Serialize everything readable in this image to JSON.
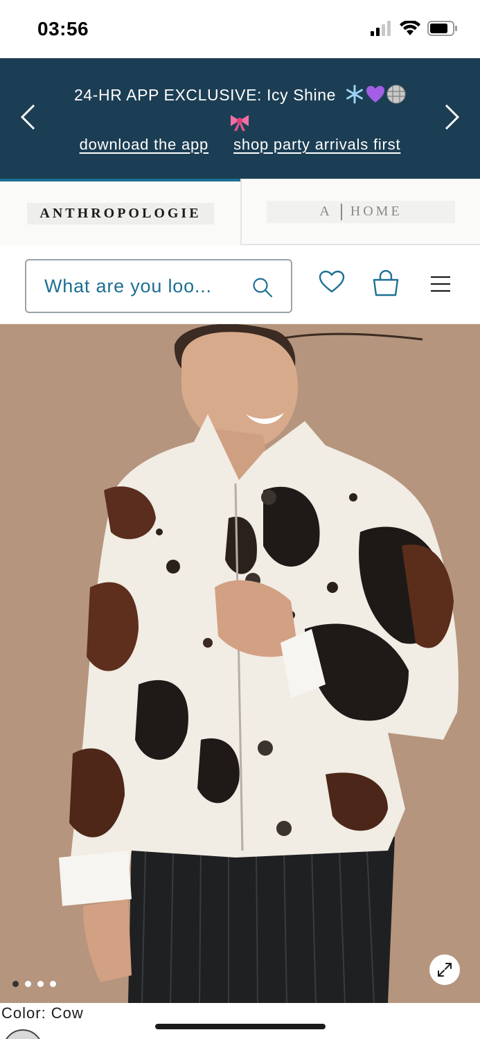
{
  "status_bar": {
    "time": "03:56",
    "icons": [
      "cellular-signal-icon",
      "wifi-icon",
      "battery-icon"
    ]
  },
  "promo_banner": {
    "title": "24-HR APP EXCLUSIVE: Icy Shine",
    "emojis": [
      "❄️",
      "💜",
      "🪩",
      "🎀"
    ],
    "links": [
      "download the app",
      "shop party arrivals first"
    ],
    "background": "#1c3e54"
  },
  "brand_tabs": {
    "active": "ANTHROPOLOGIE",
    "inactive_prefix": "A",
    "inactive_label": "HOME",
    "accent": "#1c6f94"
  },
  "header": {
    "search_placeholder": "What are you loo...",
    "icons": [
      "search-icon",
      "heart-icon",
      "shopping-bag-icon",
      "hamburger-menu-icon"
    ]
  },
  "product": {
    "image_dots_count": 4,
    "active_dot": 1,
    "color_label": "Color: Cow"
  }
}
